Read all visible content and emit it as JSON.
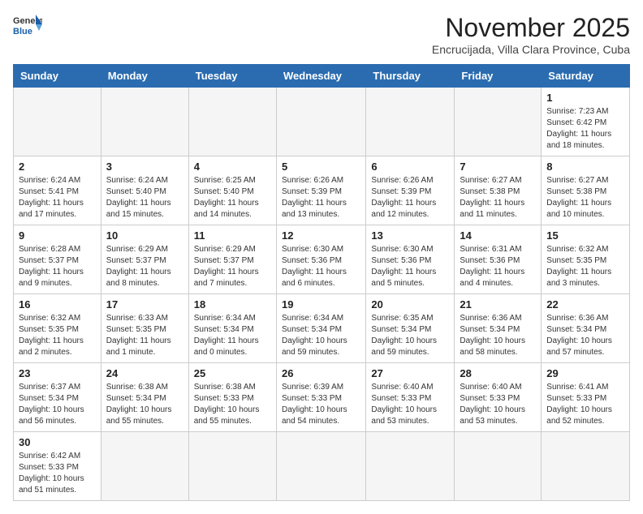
{
  "header": {
    "logo_general": "General",
    "logo_blue": "Blue",
    "month_title": "November 2025",
    "location": "Encrucijada, Villa Clara Province, Cuba"
  },
  "days_of_week": [
    "Sunday",
    "Monday",
    "Tuesday",
    "Wednesday",
    "Thursday",
    "Friday",
    "Saturday"
  ],
  "weeks": [
    [
      {
        "day": "",
        "info": ""
      },
      {
        "day": "",
        "info": ""
      },
      {
        "day": "",
        "info": ""
      },
      {
        "day": "",
        "info": ""
      },
      {
        "day": "",
        "info": ""
      },
      {
        "day": "",
        "info": ""
      },
      {
        "day": "1",
        "info": "Sunrise: 7:23 AM\nSunset: 6:42 PM\nDaylight: 11 hours and 18 minutes."
      }
    ],
    [
      {
        "day": "2",
        "info": "Sunrise: 6:24 AM\nSunset: 5:41 PM\nDaylight: 11 hours and 17 minutes."
      },
      {
        "day": "3",
        "info": "Sunrise: 6:24 AM\nSunset: 5:40 PM\nDaylight: 11 hours and 15 minutes."
      },
      {
        "day": "4",
        "info": "Sunrise: 6:25 AM\nSunset: 5:40 PM\nDaylight: 11 hours and 14 minutes."
      },
      {
        "day": "5",
        "info": "Sunrise: 6:26 AM\nSunset: 5:39 PM\nDaylight: 11 hours and 13 minutes."
      },
      {
        "day": "6",
        "info": "Sunrise: 6:26 AM\nSunset: 5:39 PM\nDaylight: 11 hours and 12 minutes."
      },
      {
        "day": "7",
        "info": "Sunrise: 6:27 AM\nSunset: 5:38 PM\nDaylight: 11 hours and 11 minutes."
      },
      {
        "day": "8",
        "info": "Sunrise: 6:27 AM\nSunset: 5:38 PM\nDaylight: 11 hours and 10 minutes."
      }
    ],
    [
      {
        "day": "9",
        "info": "Sunrise: 6:28 AM\nSunset: 5:37 PM\nDaylight: 11 hours and 9 minutes."
      },
      {
        "day": "10",
        "info": "Sunrise: 6:29 AM\nSunset: 5:37 PM\nDaylight: 11 hours and 8 minutes."
      },
      {
        "day": "11",
        "info": "Sunrise: 6:29 AM\nSunset: 5:37 PM\nDaylight: 11 hours and 7 minutes."
      },
      {
        "day": "12",
        "info": "Sunrise: 6:30 AM\nSunset: 5:36 PM\nDaylight: 11 hours and 6 minutes."
      },
      {
        "day": "13",
        "info": "Sunrise: 6:30 AM\nSunset: 5:36 PM\nDaylight: 11 hours and 5 minutes."
      },
      {
        "day": "14",
        "info": "Sunrise: 6:31 AM\nSunset: 5:36 PM\nDaylight: 11 hours and 4 minutes."
      },
      {
        "day": "15",
        "info": "Sunrise: 6:32 AM\nSunset: 5:35 PM\nDaylight: 11 hours and 3 minutes."
      }
    ],
    [
      {
        "day": "16",
        "info": "Sunrise: 6:32 AM\nSunset: 5:35 PM\nDaylight: 11 hours and 2 minutes."
      },
      {
        "day": "17",
        "info": "Sunrise: 6:33 AM\nSunset: 5:35 PM\nDaylight: 11 hours and 1 minute."
      },
      {
        "day": "18",
        "info": "Sunrise: 6:34 AM\nSunset: 5:34 PM\nDaylight: 11 hours and 0 minutes."
      },
      {
        "day": "19",
        "info": "Sunrise: 6:34 AM\nSunset: 5:34 PM\nDaylight: 10 hours and 59 minutes."
      },
      {
        "day": "20",
        "info": "Sunrise: 6:35 AM\nSunset: 5:34 PM\nDaylight: 10 hours and 59 minutes."
      },
      {
        "day": "21",
        "info": "Sunrise: 6:36 AM\nSunset: 5:34 PM\nDaylight: 10 hours and 58 minutes."
      },
      {
        "day": "22",
        "info": "Sunrise: 6:36 AM\nSunset: 5:34 PM\nDaylight: 10 hours and 57 minutes."
      }
    ],
    [
      {
        "day": "23",
        "info": "Sunrise: 6:37 AM\nSunset: 5:34 PM\nDaylight: 10 hours and 56 minutes."
      },
      {
        "day": "24",
        "info": "Sunrise: 6:38 AM\nSunset: 5:34 PM\nDaylight: 10 hours and 55 minutes."
      },
      {
        "day": "25",
        "info": "Sunrise: 6:38 AM\nSunset: 5:33 PM\nDaylight: 10 hours and 55 minutes."
      },
      {
        "day": "26",
        "info": "Sunrise: 6:39 AM\nSunset: 5:33 PM\nDaylight: 10 hours and 54 minutes."
      },
      {
        "day": "27",
        "info": "Sunrise: 6:40 AM\nSunset: 5:33 PM\nDaylight: 10 hours and 53 minutes."
      },
      {
        "day": "28",
        "info": "Sunrise: 6:40 AM\nSunset: 5:33 PM\nDaylight: 10 hours and 53 minutes."
      },
      {
        "day": "29",
        "info": "Sunrise: 6:41 AM\nSunset: 5:33 PM\nDaylight: 10 hours and 52 minutes."
      }
    ],
    [
      {
        "day": "30",
        "info": "Sunrise: 6:42 AM\nSunset: 5:33 PM\nDaylight: 10 hours and 51 minutes."
      },
      {
        "day": "",
        "info": ""
      },
      {
        "day": "",
        "info": ""
      },
      {
        "day": "",
        "info": ""
      },
      {
        "day": "",
        "info": ""
      },
      {
        "day": "",
        "info": ""
      },
      {
        "day": "",
        "info": ""
      }
    ]
  ]
}
